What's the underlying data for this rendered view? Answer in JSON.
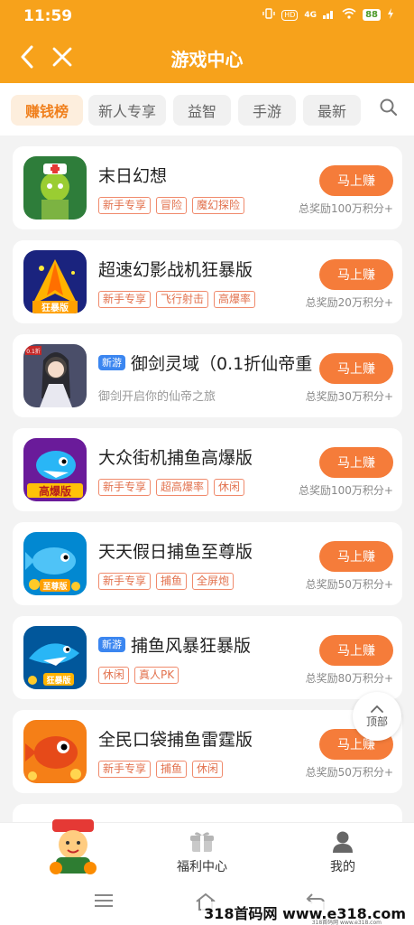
{
  "status_bar": {
    "time": "11:59",
    "network_label": "HD",
    "signal_label": "4G",
    "battery": "88"
  },
  "header": {
    "title": "游戏中心"
  },
  "tabs": [
    {
      "label": "赚钱榜",
      "active": true
    },
    {
      "label": "新人专享",
      "active": false
    },
    {
      "label": "益智",
      "active": false
    },
    {
      "label": "手游",
      "active": false
    },
    {
      "label": "最新",
      "active": false
    }
  ],
  "games": [
    {
      "name": "末日幻想",
      "tags": [
        "新手专享",
        "冒险",
        "魔幻探险"
      ],
      "button": "马上赚",
      "reward": "总奖励100万积分+"
    },
    {
      "name": "超速幻影战机狂暴版",
      "icon_text": "狂暴版",
      "tags": [
        "新手专享",
        "飞行射击",
        "高爆率"
      ],
      "button": "马上赚",
      "reward": "总奖励20万积分+"
    },
    {
      "name": "御剑灵域（0.1折仙帝重",
      "badge": "新游",
      "icon_text": "0.1折",
      "description": "御剑开启你的仙帝之旅",
      "button": "马上赚",
      "reward": "总奖励30万积分+"
    },
    {
      "name": "大众街机捕鱼高爆版",
      "icon_text": "高爆版",
      "tags": [
        "新手专享",
        "超高爆率",
        "休闲"
      ],
      "button": "马上赚",
      "reward": "总奖励100万积分+"
    },
    {
      "name": "天天假日捕鱼至尊版",
      "icon_text": "至尊版",
      "tags": [
        "新手专享",
        "捕鱼",
        "全屏炮"
      ],
      "button": "马上赚",
      "reward": "总奖励50万积分+"
    },
    {
      "name": "捕鱼风暴狂暴版",
      "badge": "新游",
      "icon_text": "狂暴版",
      "tags": [
        "休闲",
        "真人PK"
      ],
      "button": "马上赚",
      "reward": "总奖励80万积分+"
    },
    {
      "name": "全民口袋捕鱼雷霆版",
      "tags": [
        "新手专享",
        "捕鱼",
        "休闲"
      ],
      "button": "马上赚",
      "reward": "总奖励50万积分+"
    }
  ],
  "top_button": {
    "label": "顶部"
  },
  "bottom_nav": {
    "welfare": "福利中心",
    "mine": "我的"
  },
  "watermark": {
    "text": "318首码网 www.e318.com",
    "sub": "318首码网 www.e318.com"
  },
  "colors": {
    "brand": "#f7a21b",
    "action": "#f57c3a",
    "tag": "#e2714d",
    "new_badge": "#3b86f0"
  }
}
